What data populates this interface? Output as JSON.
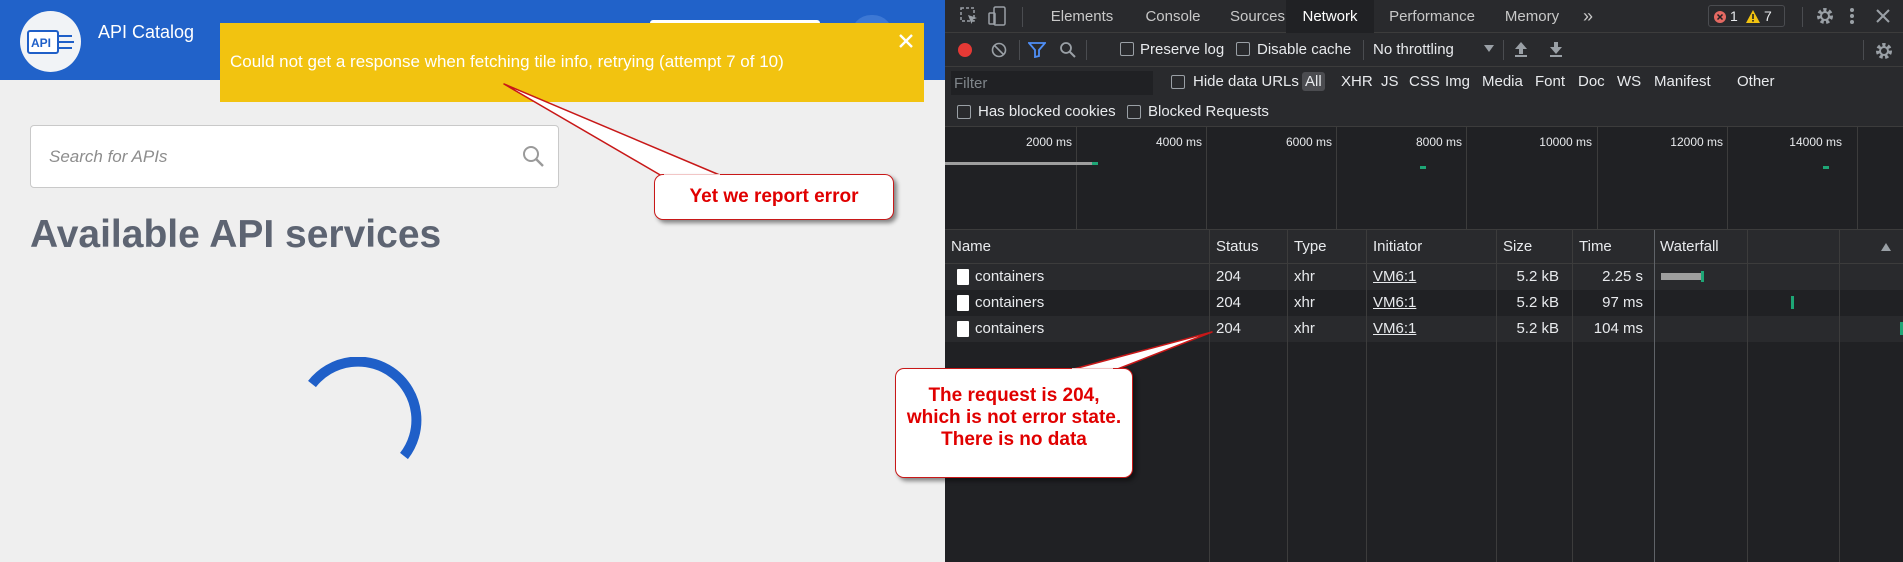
{
  "app": {
    "title": "API Catalog",
    "logo_text": "API",
    "page_title": "Available API services",
    "search": {
      "placeholder": "Search for APIs"
    },
    "notification": {
      "message": "Could not get a response when fetching tile info, retrying (attempt 7 of 10)"
    }
  },
  "annotations": {
    "callout_error": "Yet we report error",
    "callout_status_lines": [
      "The request is 204,",
      "which is not error state.",
      "There is no data"
    ]
  },
  "devtools": {
    "tabs": [
      "Elements",
      "Console",
      "Sources",
      "Network",
      "Performance",
      "Memory"
    ],
    "active_tab": "Network",
    "more_tabs_label": "»",
    "error_count": "1",
    "warning_count": "7",
    "toolbar": {
      "preserve_log": "Preserve log",
      "disable_cache": "Disable cache",
      "throttling": "No throttling"
    },
    "filter": {
      "placeholder": "Filter",
      "hide_data_urls": "Hide data URLs",
      "types": [
        "All",
        "XHR",
        "JS",
        "CSS",
        "Img",
        "Media",
        "Font",
        "Doc",
        "WS",
        "Manifest",
        "Other"
      ],
      "has_blocked_cookies": "Has blocked cookies",
      "blocked_requests": "Blocked Requests"
    },
    "overview": {
      "ticks": [
        "2000 ms",
        "4000 ms",
        "6000 ms",
        "8000 ms",
        "10000 ms",
        "12000 ms",
        "14000 ms"
      ]
    },
    "table": {
      "columns": [
        "Name",
        "Status",
        "Type",
        "Initiator",
        "Size",
        "Time",
        "Waterfall"
      ],
      "rows": [
        {
          "name": "containers",
          "status": "204",
          "type": "xhr",
          "initiator": "VM6:1",
          "size": "5.2 kB",
          "time": "2.25 s"
        },
        {
          "name": "containers",
          "status": "204",
          "type": "xhr",
          "initiator": "VM6:1",
          "size": "5.2 kB",
          "time": "97 ms"
        },
        {
          "name": "containers",
          "status": "204",
          "type": "xhr",
          "initiator": "VM6:1",
          "size": "5.2 kB",
          "time": "104 ms"
        }
      ]
    }
  },
  "colors": {
    "header_blue": "#2162c9",
    "toast_yellow": "#f2c310",
    "spinner_blue": "#1f5fc8",
    "annotation_red": "#e00000",
    "devtools_bg": "#202124",
    "waterfall_green": "#1ea676"
  }
}
